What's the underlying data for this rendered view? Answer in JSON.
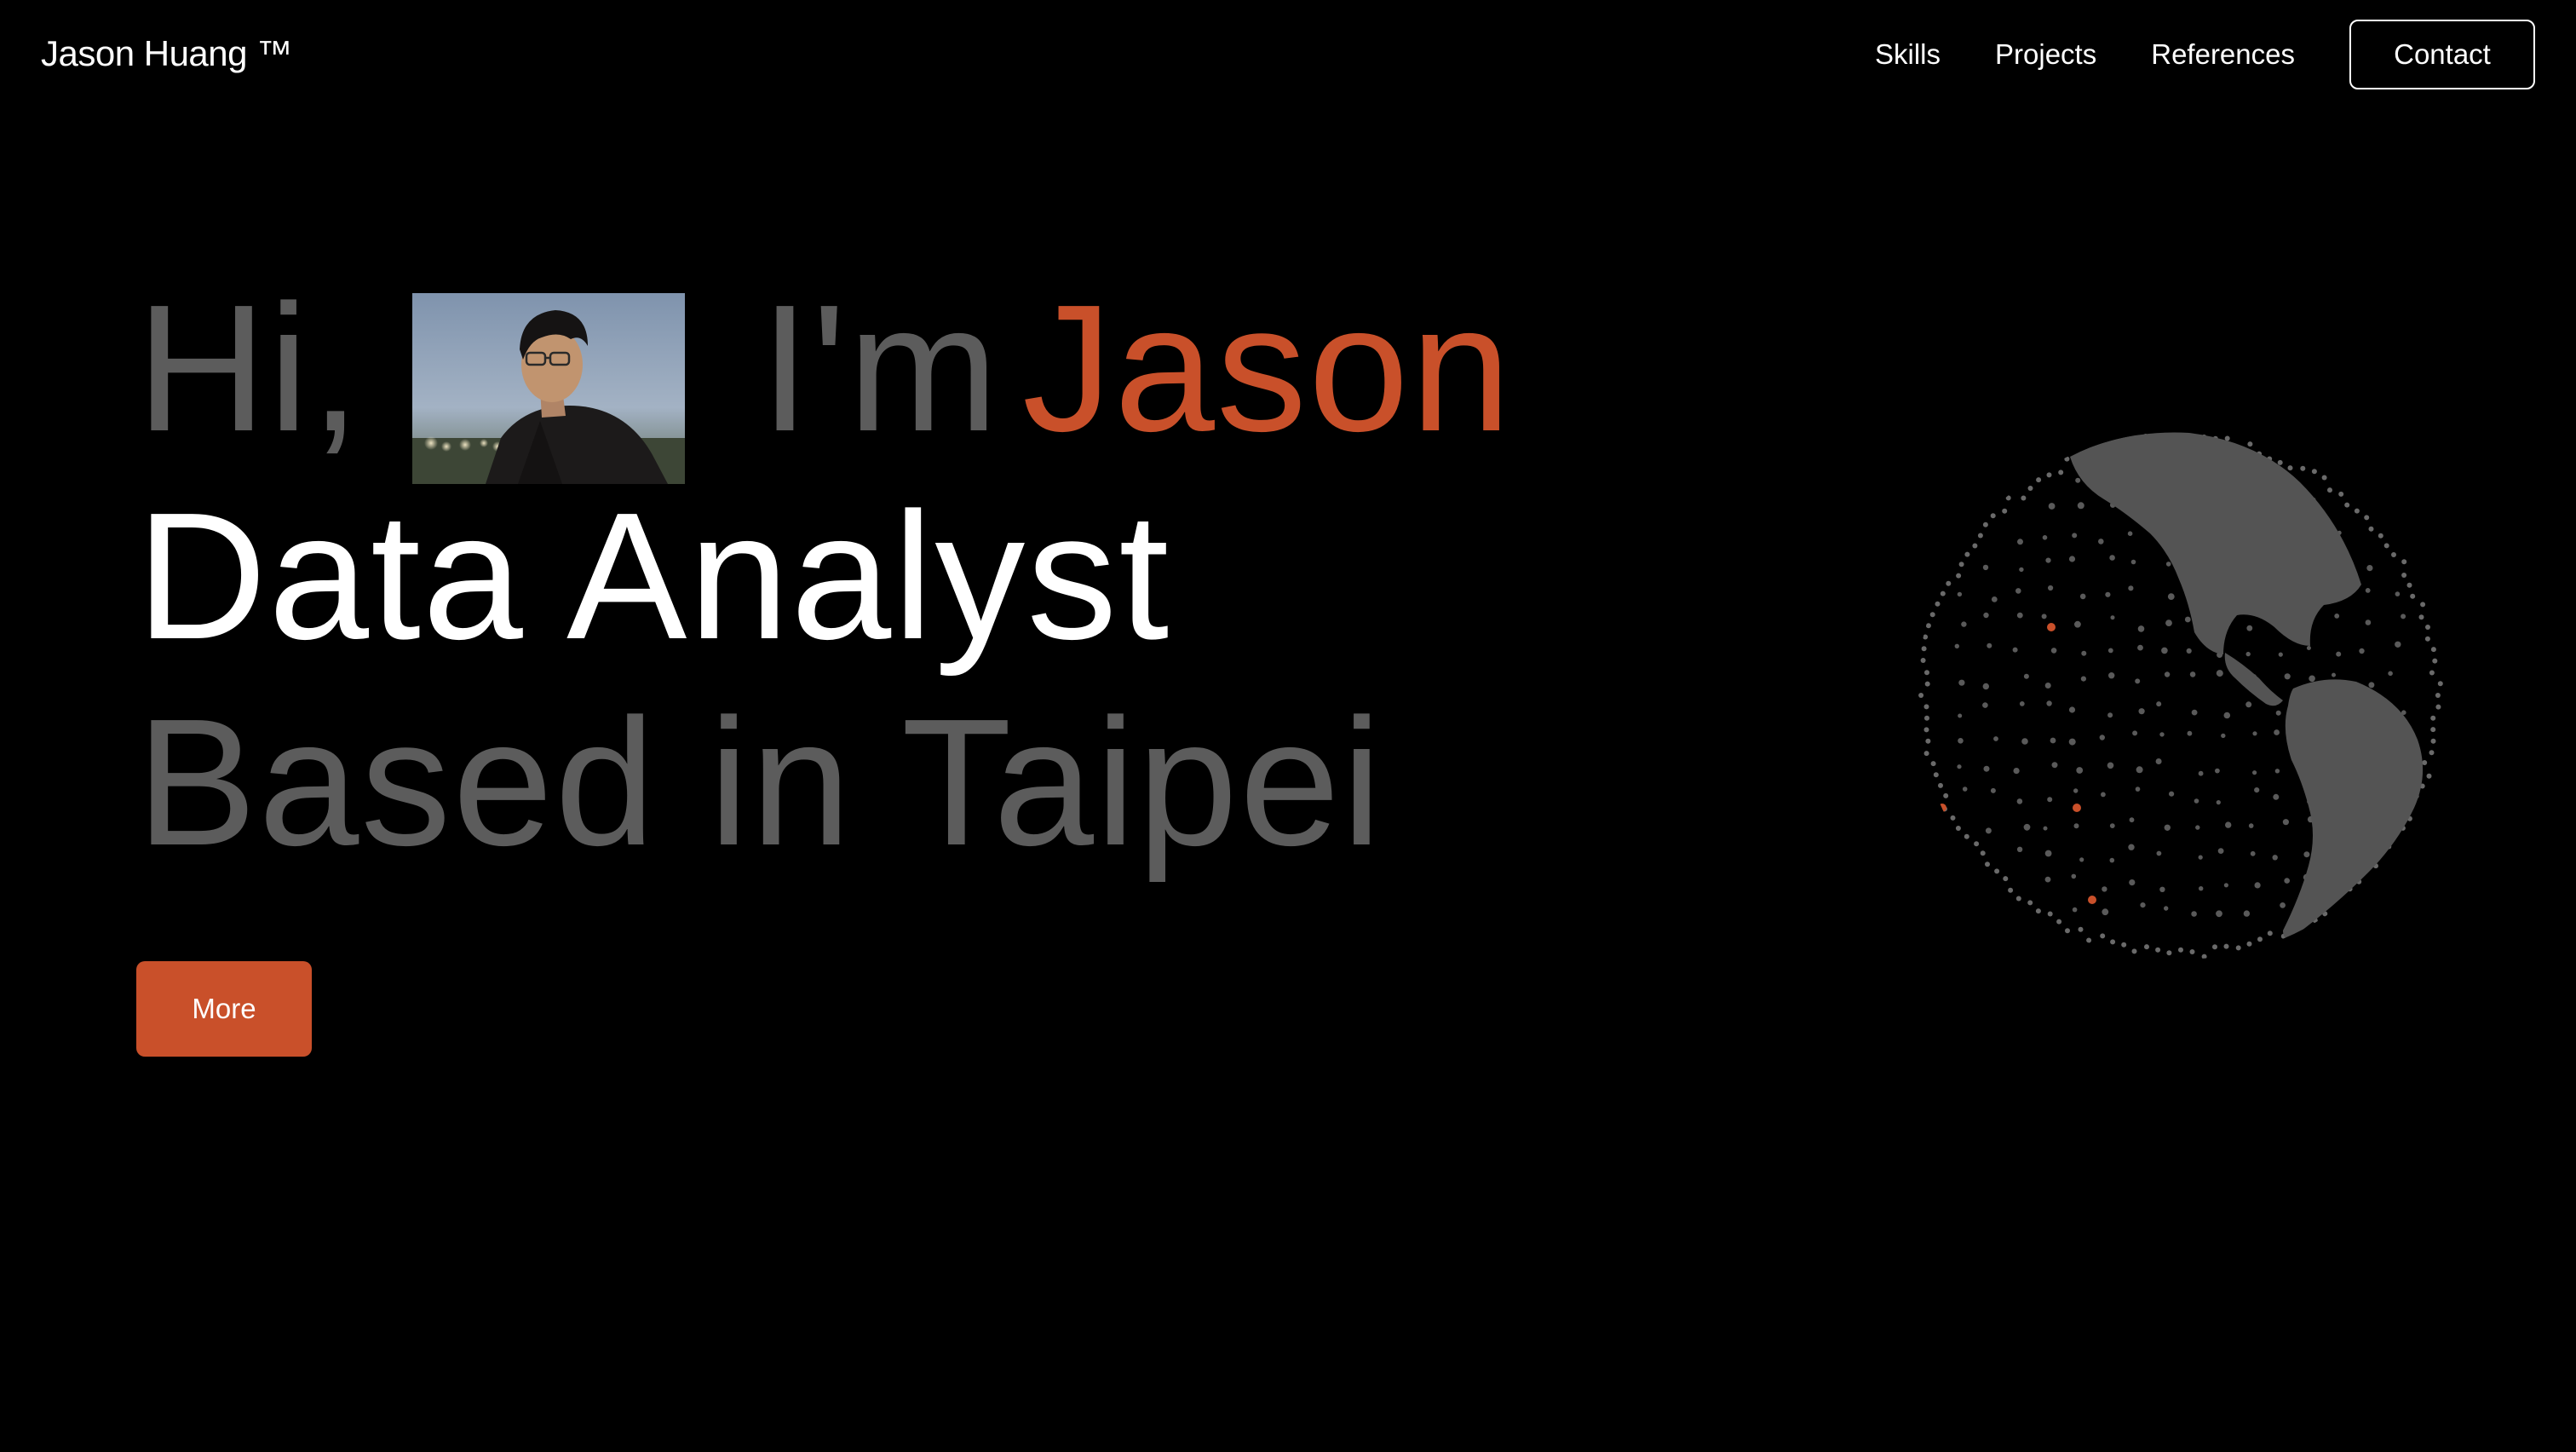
{
  "header": {
    "brand": "Jason Huang ™",
    "nav": [
      {
        "label": "Skills"
      },
      {
        "label": "Projects"
      },
      {
        "label": "References"
      }
    ],
    "contact_label": "Contact"
  },
  "hero": {
    "greeting": "Hi,",
    "intro": "I'm",
    "name": "Jason",
    "role": "Data Analyst",
    "location": "Based in Taipei",
    "more_label": "More"
  },
  "colors": {
    "background": "#000000",
    "accent": "#c9502a",
    "muted_text": "#5c5c5c",
    "primary_text": "#ffffff"
  },
  "icons": {
    "globe": "dotted-globe-icon"
  }
}
